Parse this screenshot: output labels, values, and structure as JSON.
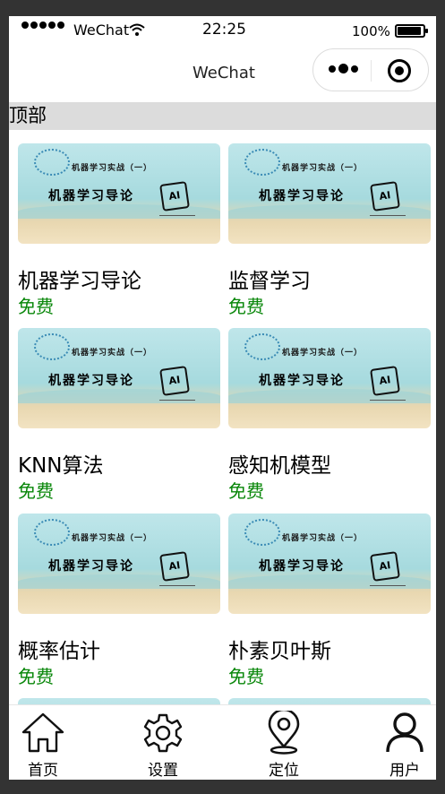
{
  "status_bar": {
    "carrier": "WeChat",
    "time": "22:25",
    "battery": "100%"
  },
  "nav": {
    "title": "WeChat",
    "capsule_icons": [
      "more-dots-icon",
      "miniprogram-target-icon"
    ]
  },
  "section": {
    "title": "顶部"
  },
  "thumbnail": {
    "subtitle": "机器学习实战（一）",
    "title": "机器学习导论",
    "badge": "AI"
  },
  "courses": [
    {
      "title": "机器学习导论",
      "price": "免费"
    },
    {
      "title": "监督学习",
      "price": "免费"
    },
    {
      "title": "KNN算法",
      "price": "免费"
    },
    {
      "title": "感知机模型",
      "price": "免费"
    },
    {
      "title": "概率估计",
      "price": "免费"
    },
    {
      "title": "朴素贝叶斯",
      "price": "免费"
    },
    {
      "title": "",
      "price": ""
    },
    {
      "title": "",
      "price": ""
    }
  ],
  "tabs": [
    {
      "label": "首页",
      "icon": "home-icon"
    },
    {
      "label": "设置",
      "icon": "gear-icon"
    },
    {
      "label": "定位",
      "icon": "location-pin-icon"
    },
    {
      "label": "用户",
      "icon": "user-icon"
    }
  ],
  "colors": {
    "price": "#09870a",
    "section_bg": "#dcdcdc",
    "frame": "#333333"
  }
}
